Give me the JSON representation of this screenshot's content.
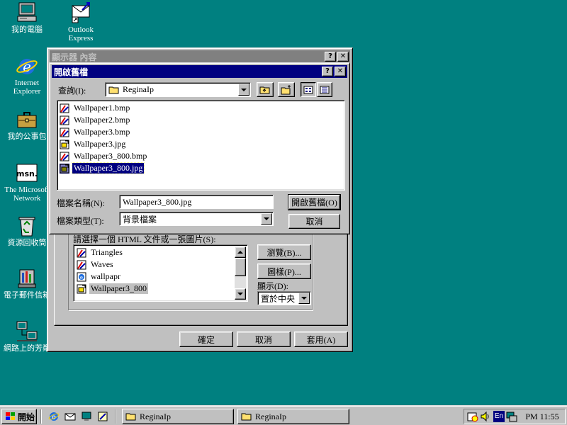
{
  "desktop": {
    "icons": [
      {
        "label": "我的電腦",
        "icon": "my-computer-icon"
      },
      {
        "label": "Outlook\nExpress",
        "icon": "outlook-express-icon"
      },
      {
        "label": "Internet\nExplorer",
        "icon": "internet-explorer-icon"
      },
      {
        "label": "我的公事包",
        "icon": "briefcase-icon"
      },
      {
        "label": "The Microsoft\nNetwork",
        "icon": "msn-icon"
      },
      {
        "label": "資源回收筒",
        "icon": "recycle-bin-icon"
      },
      {
        "label": "電子郵件信箱",
        "icon": "inbox-icon"
      },
      {
        "label": "網路上的芳鄰",
        "icon": "network-neighborhood-icon"
      }
    ]
  },
  "display_properties": {
    "title": "顯示器 內容",
    "help_glyph": "?",
    "close_glyph": "✕",
    "list_label": "請選擇一個 HTML 文件或一張圖片(S):",
    "items": [
      {
        "label": "Triangles",
        "icon": "bmp-file-icon"
      },
      {
        "label": "Waves",
        "icon": "bmp-file-icon"
      },
      {
        "label": "wallpapr",
        "icon": "html-file-icon"
      },
      {
        "label": "Wallpaper3_800",
        "icon": "jpg-file-icon"
      }
    ],
    "browse_button": "瀏覽(B)...",
    "pattern_button": "圖樣(P)...",
    "display_label": "顯示(D):",
    "display_value": "置於中央",
    "ok_button": "確定",
    "cancel_button": "取消",
    "apply_button": "套用(A)"
  },
  "open_dialog": {
    "title": "開啟舊檔",
    "help_glyph": "?",
    "close_glyph": "✕",
    "look_in_label": "查詢(I):",
    "look_in_value": "ReginaIp",
    "files": [
      {
        "name": "Wallpaper1.bmp",
        "icon": "bmp-file-icon"
      },
      {
        "name": "Wallpaper2.bmp",
        "icon": "bmp-file-icon"
      },
      {
        "name": "Wallpaper3.bmp",
        "icon": "bmp-file-icon"
      },
      {
        "name": "Wallpaper3.jpg",
        "icon": "jpg-file-icon"
      },
      {
        "name": "Wallpaper3_800.bmp",
        "icon": "bmp-file-icon"
      },
      {
        "name": "Wallpaper3_800.jpg",
        "icon": "jpg-file-icon"
      }
    ],
    "file_name_label": "檔案名稱(N):",
    "file_name_value": "Wallpaper3_800.jpg",
    "file_type_label": "檔案類型(T):",
    "file_type_value": "背景檔案",
    "open_button": "開啟舊檔(O)",
    "cancel_button": "取消"
  },
  "taskbar": {
    "start_label": "開始",
    "tasks": [
      {
        "label": "ReginaIp"
      },
      {
        "label": "ReginaIp"
      }
    ],
    "lang": "En",
    "clock": "PM 11:55"
  },
  "colors": {
    "desktop": "#008080",
    "active_title": "#000080",
    "inactive_title": "#808080",
    "face": "#c0c0c0"
  }
}
